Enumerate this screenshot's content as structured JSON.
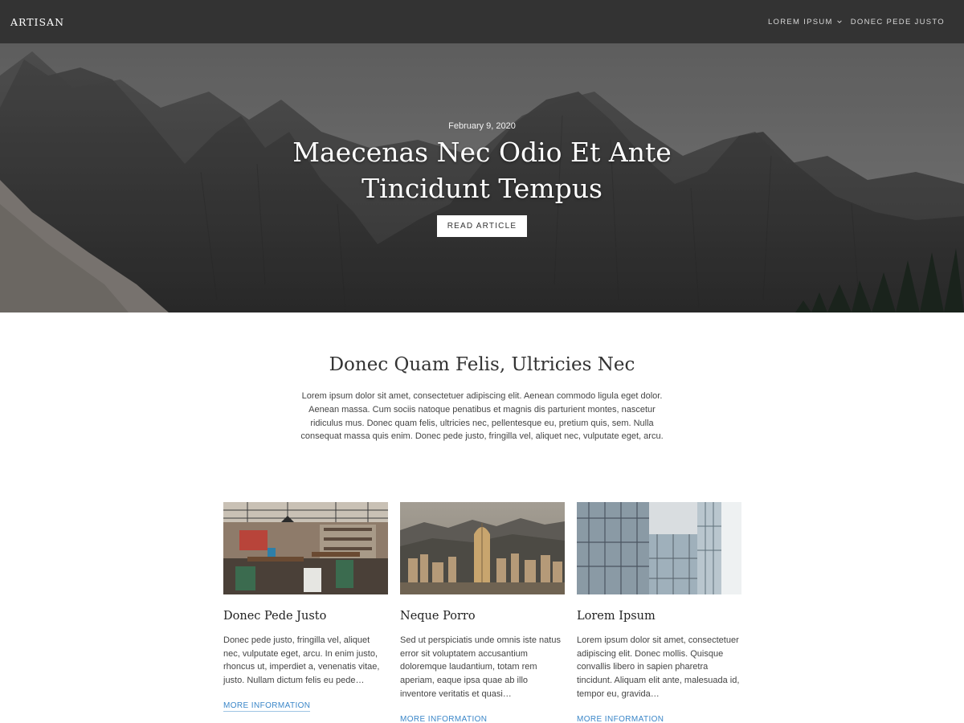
{
  "header": {
    "brand": "ARTISAN",
    "nav": [
      {
        "label": "LOREM IPSUM",
        "has_dropdown": true,
        "icon": "chevron-down-icon"
      },
      {
        "label": "DONEC PEDE JUSTO",
        "has_dropdown": false
      }
    ]
  },
  "hero": {
    "date": "February 9, 2020",
    "title": "Maecenas Nec Odio Et Ante Tincidunt Tempus",
    "button": "READ ARTICLE"
  },
  "intro": {
    "title": "Donec Quam Felis, Ultricies Nec",
    "text": "Lorem ipsum dolor sit amet, consectetuer adipiscing elit. Aenean commodo ligula eget dolor. Aenean massa. Cum sociis natoque penatibus et magnis dis parturient montes, nascetur ridiculus mus. Donec quam felis, ultricies nec, pellentesque eu, pretium quis, sem. Nulla consequat massa quis enim. Donec pede justo, fringilla vel, aliquet nec, vulputate eget, arcu."
  },
  "cards": [
    {
      "title": "Donec Pede Justo",
      "text": "Donec pede justo, fringilla vel, aliquet nec, vulputate eget, arcu. In enim justo, rhoncus ut, imperdiet a, venenatis vitae, justo. Nullam dictum felis eu pede…",
      "link": "MORE INFORMATION"
    },
    {
      "title": "Neque Porro",
      "text": "Sed ut perspiciatis unde omnis iste natus error sit voluptatem accusantium doloremque laudantium, totam rem aperiam, eaque ipsa quae ab illo inventore veritatis et quasi…",
      "link": "MORE INFORMATION"
    },
    {
      "title": "Lorem Ipsum",
      "text": "Lorem ipsum dolor sit amet, consectetuer adipiscing elit. Donec mollis. Quisque convallis libero in sapien pharetra tincidunt. Aliquam elit ante, malesuada id, tempor eu, gravida…",
      "link": "MORE INFORMATION"
    }
  ],
  "colors": {
    "header_bg": "#333333",
    "link": "#3a86c8",
    "text": "#444444"
  }
}
